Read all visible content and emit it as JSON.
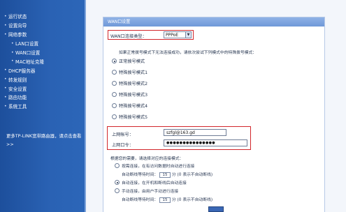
{
  "sidebar": {
    "items": [
      {
        "label": "运行状态",
        "level": 0
      },
      {
        "label": "设置向导",
        "level": 0
      },
      {
        "label": "网络参数",
        "level": 0
      },
      {
        "label": "LAN口设置",
        "level": 1
      },
      {
        "label": "WAN口设置",
        "level": 1
      },
      {
        "label": "MAC地址克隆",
        "level": 1
      },
      {
        "label": "DHCP服务器",
        "level": 0
      },
      {
        "label": "转发规则",
        "level": 0
      },
      {
        "label": "安全设置",
        "level": 0
      },
      {
        "label": "路由功能",
        "level": 0
      },
      {
        "label": "系统工具",
        "level": 0
      }
    ],
    "note": "更多TP-LINK宽带路由器，请点击查看 >>"
  },
  "panel": {
    "title": "WAN口设置",
    "wan_type_label": "WAN口连接类型：",
    "wan_type_value": "PPPoE",
    "hint": "如果正常拨号模式下无法连接成功，请依次尝试下列模式中的特殊拨号模式：",
    "dial_modes": [
      {
        "label": "正常拨号模式",
        "selected": true
      },
      {
        "label": "特殊拨号模式1",
        "selected": false
      },
      {
        "label": "特殊拨号模式2",
        "selected": false
      },
      {
        "label": "特殊拨号模式3",
        "selected": false
      },
      {
        "label": "特殊拨号模式4",
        "selected": false
      },
      {
        "label": "特殊拨号模式5",
        "selected": false
      }
    ],
    "account_label": "上网帐号：",
    "account_value": "szfgl@163.gd",
    "password_label": "上网口令：",
    "password_value": "●●●●●●●●●●●●●●●",
    "conn_hint": "根据您的需要，请选择对应的连接模式：",
    "conn_modes": [
      {
        "label": "按需连接，在有访问数据时自动进行连接",
        "selected": false
      },
      {
        "label": "自动连接，在开机和断线后自动连接",
        "selected": true
      },
      {
        "label": "手动连接，由用户手动进行连接",
        "selected": false
      }
    ],
    "idle_label": "自动断线等待时间：",
    "idle_value": "15",
    "idle_unit": "分",
    "idle_note": "(0 表示不自动断线)"
  }
}
